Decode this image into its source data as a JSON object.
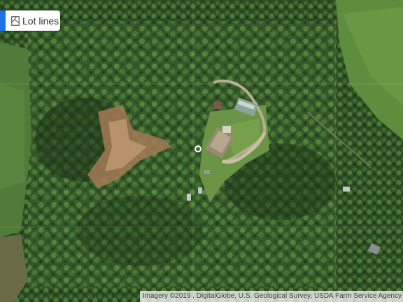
{
  "controls": {
    "lot_lines_label": "Lot lines",
    "lot_lines_icon": "lot-lines-icon",
    "accent_color": "#1a73e8"
  },
  "map": {
    "attribution": "Imagery ©2019 , DigitalGlobe, U.S. Geological Survey, USDA Farm Service Agency",
    "marker_icon": "location-circle-icon"
  }
}
